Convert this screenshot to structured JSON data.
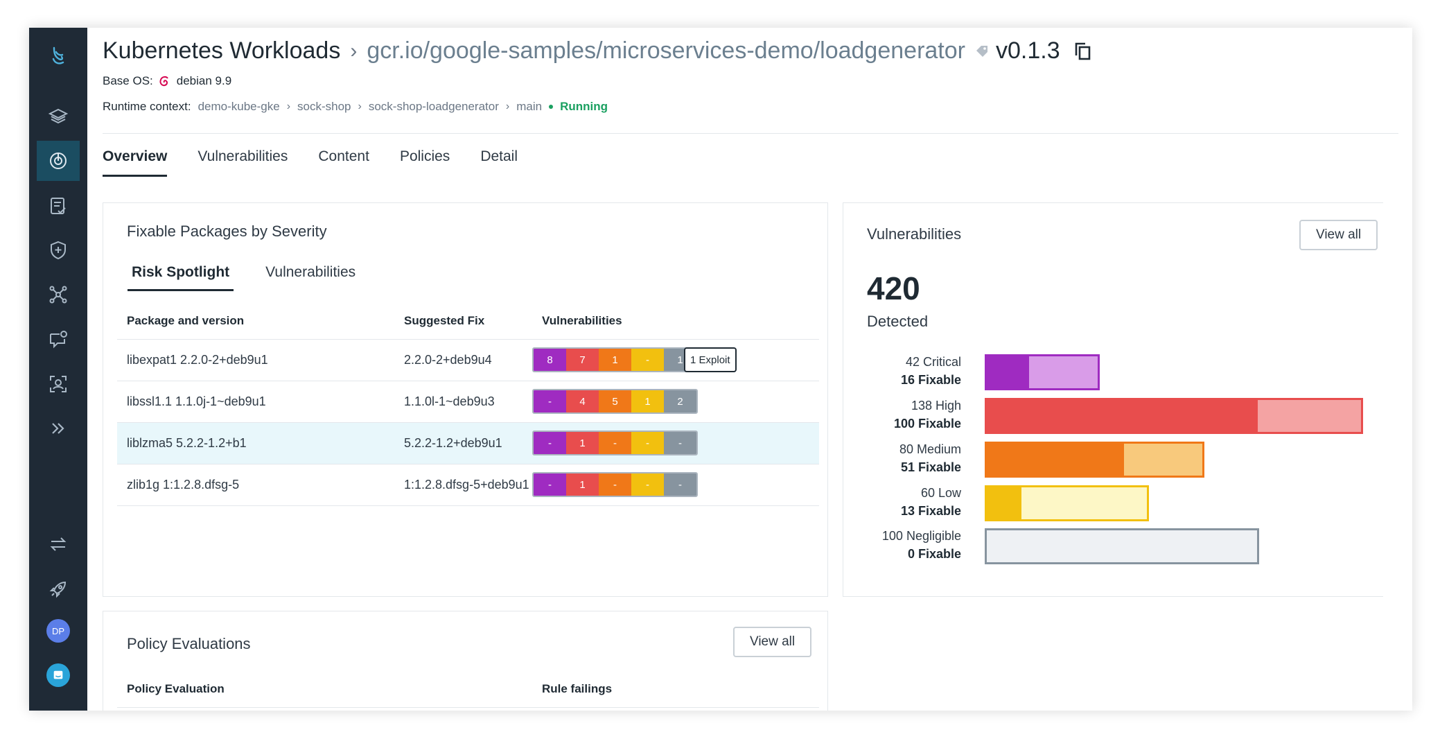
{
  "header": {
    "breadcrumb_root": "Kubernetes Workloads",
    "image_path": "gcr.io/google-samples/microservices-demo/loadgenerator",
    "version": "v0.1.3",
    "base_os_label": "Base OS:",
    "base_os_value": "debian 9.9",
    "runtime_label": "Runtime context:",
    "runtime_path": [
      "demo-kube-gke",
      "sock-shop",
      "sock-shop-loadgenerator",
      "main"
    ],
    "runtime_status": "Running"
  },
  "tabs": [
    "Overview",
    "Vulnerabilities",
    "Content",
    "Policies",
    "Detail"
  ],
  "fixable": {
    "title": "Fixable Packages by Severity",
    "subtabs": [
      "Risk Spotlight",
      "Vulnerabilities"
    ],
    "columns": [
      "Package and version",
      "Suggested Fix",
      "Vulnerabilities"
    ],
    "rows": [
      {
        "package": "libexpat1 2.2.0-2+deb9u1",
        "fix": "2.2.0-2+deb9u4",
        "sev": [
          "8",
          "7",
          "1",
          "-",
          "1"
        ],
        "exploit": "1 Exploit"
      },
      {
        "package": "libssl1.1 1.1.0j-1~deb9u1",
        "fix": "1.1.0l-1~deb9u3",
        "sev": [
          "-",
          "4",
          "5",
          "1",
          "2"
        ],
        "exploit": ""
      },
      {
        "package": "liblzma5 5.2.2-1.2+b1",
        "fix": "5.2.2-1.2+deb9u1",
        "sev": [
          "-",
          "1",
          "-",
          "-",
          "-"
        ],
        "exploit": ""
      },
      {
        "package": "zlib1g 1:1.2.8.dfsg-5",
        "fix": "1:1.2.8.dfsg-5+deb9u1",
        "sev": [
          "-",
          "1",
          "-",
          "-",
          "-"
        ],
        "exploit": ""
      }
    ]
  },
  "vulnerabilities": {
    "title": "Vulnerabilities",
    "view_all": "View all",
    "total": "420",
    "total_label": "Detected",
    "colors": {
      "critical": [
        "#9f2bc1",
        "#d99ce8"
      ],
      "high": [
        "#e84d4d",
        "#f4a3a3"
      ],
      "medium": [
        "#f07818",
        "#f8c97c"
      ],
      "low": [
        "#f2c00f",
        "#fdf7c6"
      ],
      "negligible": [
        "#87949f",
        "#eef1f4"
      ]
    },
    "rows": [
      {
        "key": "critical",
        "label": "42 Critical",
        "fixable_label": "16 Fixable",
        "total": 42,
        "fixable": 16
      },
      {
        "key": "high",
        "label": "138 High",
        "fixable_label": "100 Fixable",
        "total": 138,
        "fixable": 100
      },
      {
        "key": "medium",
        "label": "80 Medium",
        "fixable_label": "51 Fixable",
        "total": 80,
        "fixable": 51
      },
      {
        "key": "low",
        "label": "60 Low",
        "fixable_label": "13 Fixable",
        "total": 60,
        "fixable": 13
      },
      {
        "key": "negligible",
        "label": "100 Negligible",
        "fixable_label": "0 Fixable",
        "total": 100,
        "fixable": 0
      }
    ]
  },
  "policy": {
    "title": "Policy Evaluations",
    "view_all": "View all",
    "columns": [
      "Policy Evaluation",
      "Rule failings"
    ]
  },
  "sidebar": {
    "avatar_initials": "DP"
  }
}
